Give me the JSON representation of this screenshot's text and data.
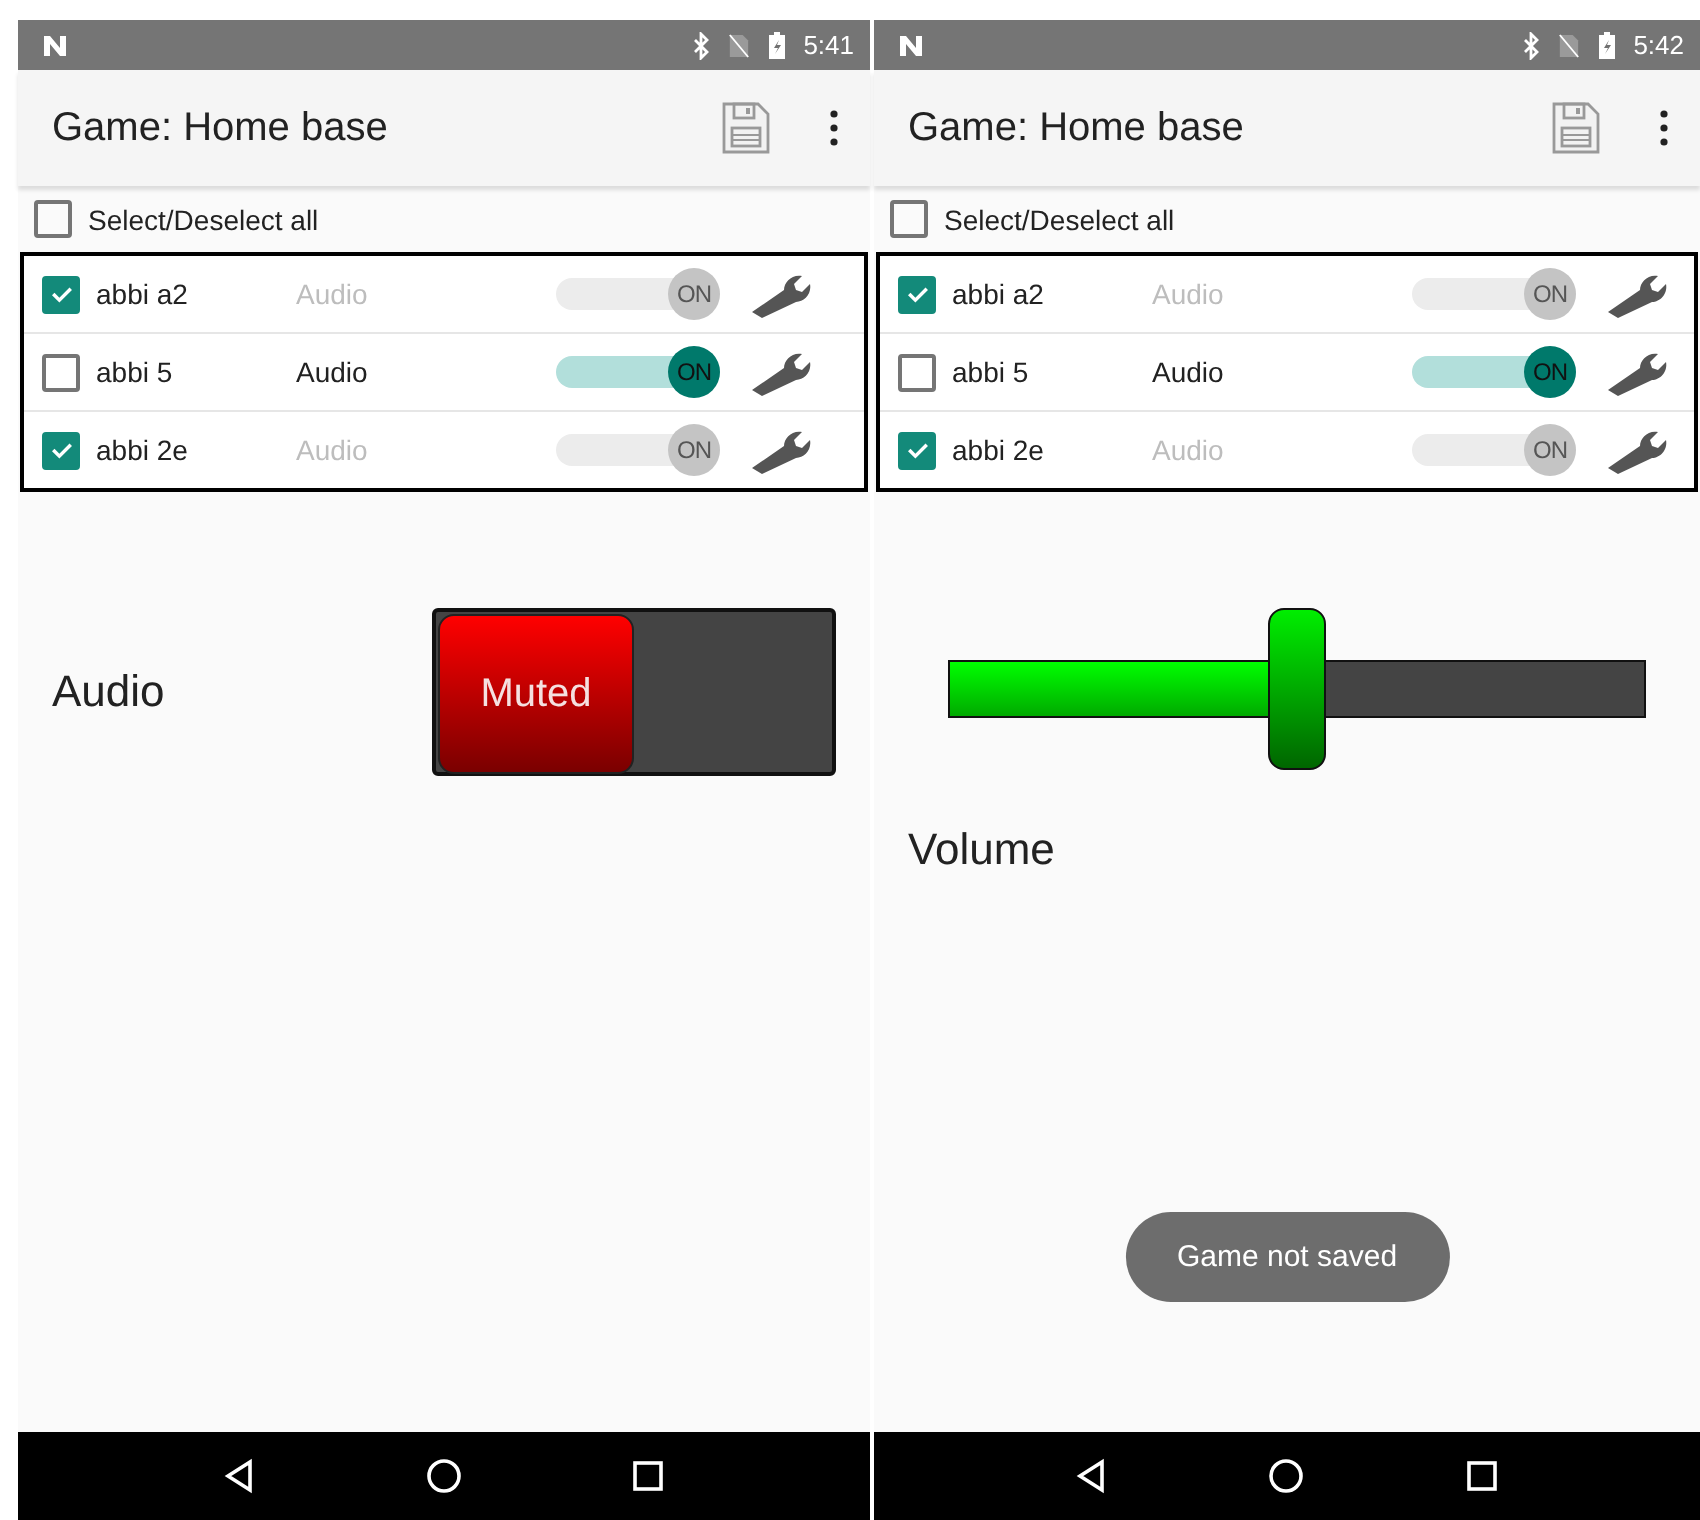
{
  "screens": [
    {
      "status_bar": {
        "time": "5:41"
      },
      "title": "Game: Home base",
      "select_all": {
        "label": "Select/Deselect all",
        "checked": false
      },
      "devices": [
        {
          "name": "abbi a2",
          "checked": true,
          "mode": "Audio",
          "disabled": true,
          "toggle": "ON",
          "on": true
        },
        {
          "name": "abbi 5",
          "checked": false,
          "mode": "Audio",
          "disabled": false,
          "toggle": "ON",
          "on": true
        },
        {
          "name": "abbi 2e",
          "checked": true,
          "mode": "Audio",
          "disabled": true,
          "toggle": "ON",
          "on": true
        }
      ],
      "control": {
        "kind": "mute",
        "label": "Audio",
        "button": "Muted",
        "muted": true
      }
    },
    {
      "status_bar": {
        "time": "5:42"
      },
      "title": "Game: Home base",
      "select_all": {
        "label": "Select/Deselect all",
        "checked": false
      },
      "devices": [
        {
          "name": "abbi a2",
          "checked": true,
          "mode": "Audio",
          "disabled": true,
          "toggle": "ON",
          "on": true
        },
        {
          "name": "abbi 5",
          "checked": false,
          "mode": "Audio",
          "disabled": false,
          "toggle": "ON",
          "on": true
        },
        {
          "name": "abbi 2e",
          "checked": true,
          "mode": "Audio",
          "disabled": true,
          "toggle": "ON",
          "on": true
        }
      ],
      "control": {
        "kind": "slider",
        "label": "Volume",
        "level": 0.5
      },
      "toast": "Game not saved"
    }
  ]
}
